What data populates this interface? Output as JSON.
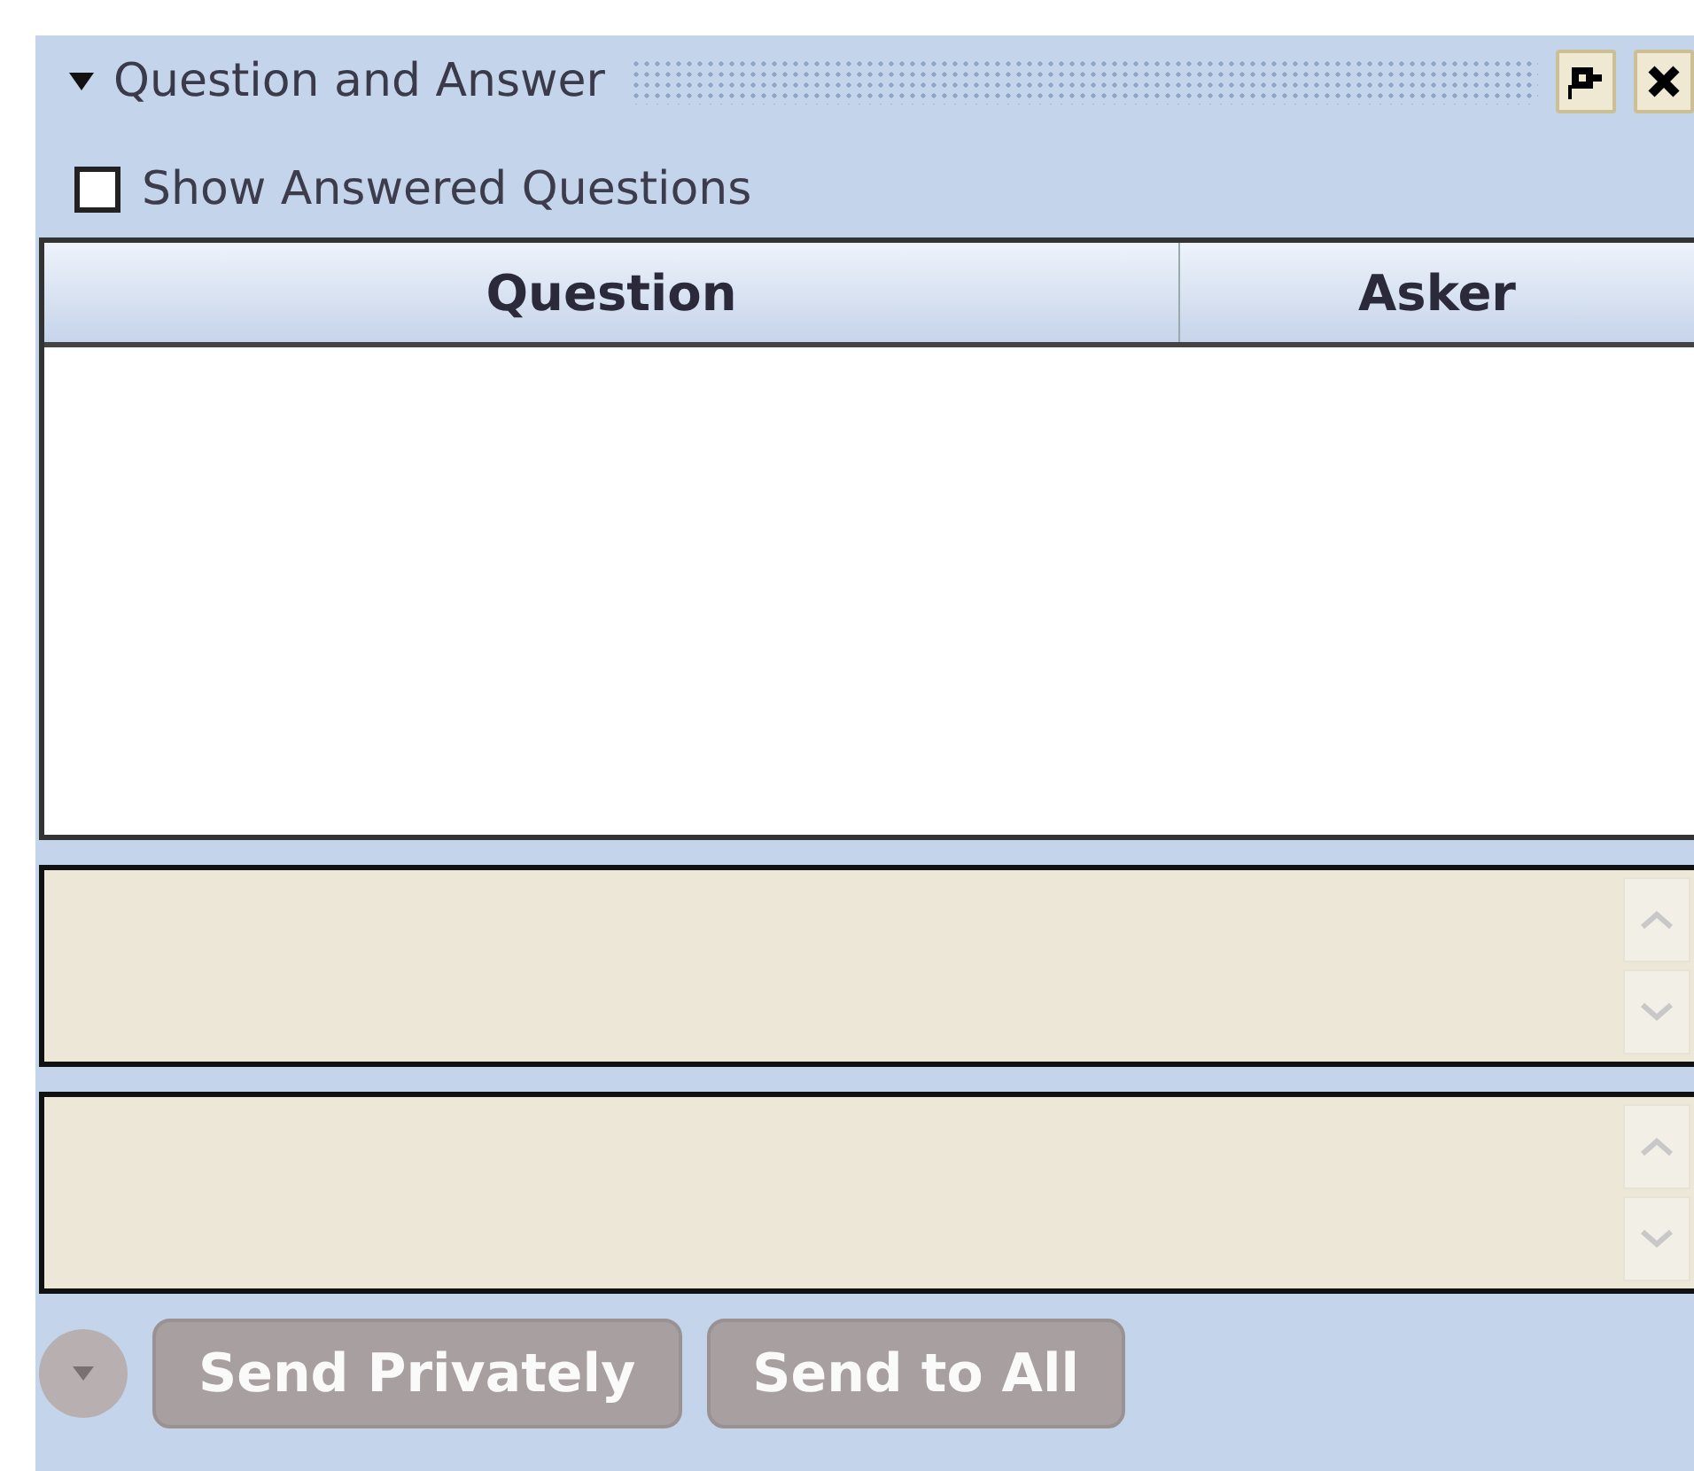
{
  "panel": {
    "title": "Question and Answer",
    "expanded": true
  },
  "show_answered": {
    "label": "Show Answered Questions",
    "checked": false
  },
  "table": {
    "columns": [
      {
        "label": "Question"
      },
      {
        "label": "Asker"
      }
    ]
  },
  "buttons": [
    {
      "kind": "menu",
      "disabled": true
    },
    {
      "kind": "text",
      "label": "Send Privately",
      "disabled": true
    },
    {
      "kind": "text",
      "label": "Send to All",
      "disabled": true
    }
  ]
}
